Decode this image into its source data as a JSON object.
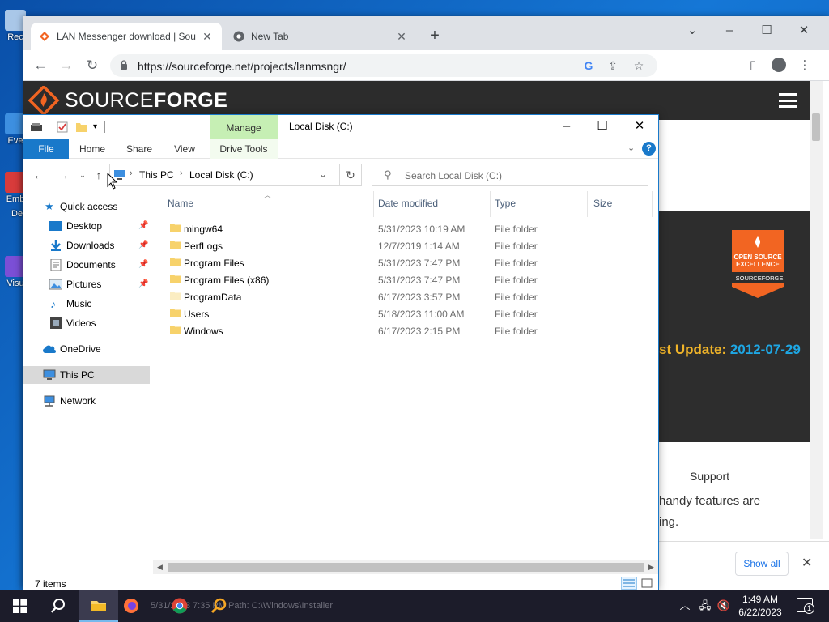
{
  "desktop": {
    "icons": [
      {
        "label": "Rec",
        "color": "#a9c7e8"
      },
      {
        "label": "Eve",
        "color": "#3d8fe0"
      },
      {
        "label": "Emb",
        "color": "#d83b3b"
      },
      {
        "label": "Visu",
        "color": "#7b4fd6"
      }
    ],
    "icon_fragments": [
      "Dex"
    ]
  },
  "browser": {
    "tabs": [
      {
        "title": "LAN Messenger download | Sou",
        "favicon": "sourceforge-icon",
        "active": true
      },
      {
        "title": "New Tab",
        "favicon": "chrome-icon",
        "active": false
      }
    ],
    "new_tab": "+",
    "url": "https://sourceforge.net/projects/lanmsngr/",
    "window_controls": {
      "collapse": "⌄",
      "minimize": "–",
      "maximize": "☐",
      "close": "✕"
    }
  },
  "sourceforge": {
    "logo_text_light": "SOURCE",
    "logo_text_bold": "FORGE",
    "badge": {
      "line1": "OPEN SOURCE",
      "line2": "EXCELLENCE",
      "brand": "SOURCEFORGE"
    },
    "last_update_label": "st Update: ",
    "last_update_value": "2012-07-29",
    "support": "Support",
    "features_line1": "handy features are",
    "features_line2": "ing.",
    "show_all": "Show all",
    "colors": {
      "header": "#2c2c2c",
      "accent_orange": "#f26522",
      "date_blue": "#1ea7e4",
      "gold": "#f0b429"
    }
  },
  "explorer": {
    "manage_tab": "Manage",
    "title": "Local Disk (C:)",
    "ribbon_tabs": [
      "File",
      "Home",
      "Share",
      "View",
      "Drive Tools"
    ],
    "breadcrumb": [
      "This PC",
      "Local Disk (C:)"
    ],
    "search_placeholder": "Search Local Disk (C:)",
    "nav": [
      {
        "label": "Quick access",
        "icon": "star-icon",
        "indent": 1,
        "pinned": false
      },
      {
        "label": "Desktop",
        "icon": "desktop-folder-icon",
        "indent": 2,
        "pinned": true
      },
      {
        "label": "Downloads",
        "icon": "download-icon",
        "indent": 2,
        "pinned": true
      },
      {
        "label": "Documents",
        "icon": "documents-icon",
        "indent": 2,
        "pinned": true
      },
      {
        "label": "Pictures",
        "icon": "pictures-icon",
        "indent": 2,
        "pinned": true
      },
      {
        "label": "Music",
        "icon": "music-icon",
        "indent": 2,
        "pinned": false
      },
      {
        "label": "Videos",
        "icon": "videos-icon",
        "indent": 2,
        "pinned": false
      },
      {
        "label": "OneDrive",
        "icon": "cloud-icon",
        "indent": 1,
        "pinned": false
      },
      {
        "label": "This PC",
        "icon": "computer-icon",
        "indent": 1,
        "pinned": false,
        "selected": true
      },
      {
        "label": "Network",
        "icon": "network-icon",
        "indent": 1,
        "pinned": false
      }
    ],
    "columns": [
      "Name",
      "Date modified",
      "Type",
      "Size"
    ],
    "files": [
      {
        "name": "mingw64",
        "date": "5/31/2023 10:19 AM",
        "type": "File folder"
      },
      {
        "name": "PerfLogs",
        "date": "12/7/2019 1:14 AM",
        "type": "File folder"
      },
      {
        "name": "Program Files",
        "date": "5/31/2023 7:47 PM",
        "type": "File folder"
      },
      {
        "name": "Program Files (x86)",
        "date": "5/31/2023 7:47 PM",
        "type": "File folder"
      },
      {
        "name": "ProgramData",
        "date": "6/17/2023 3:57 PM",
        "type": "File folder",
        "hidden": true
      },
      {
        "name": "Users",
        "date": "5/18/2023 11:00 AM",
        "type": "File folder"
      },
      {
        "name": "Windows",
        "date": "6/17/2023 2:15 PM",
        "type": "File folder"
      }
    ],
    "status": "7 items",
    "colors": {
      "accent": "#1979ca",
      "manage": "#c6efb4",
      "folder": "#f7d26b"
    }
  },
  "taskbar": {
    "ghost_text": "5/31/2023 7:35 PM   Path: C:\\Windows\\Installer",
    "time": "1:49 AM",
    "date": "6/22/2023",
    "notifications": "1"
  }
}
